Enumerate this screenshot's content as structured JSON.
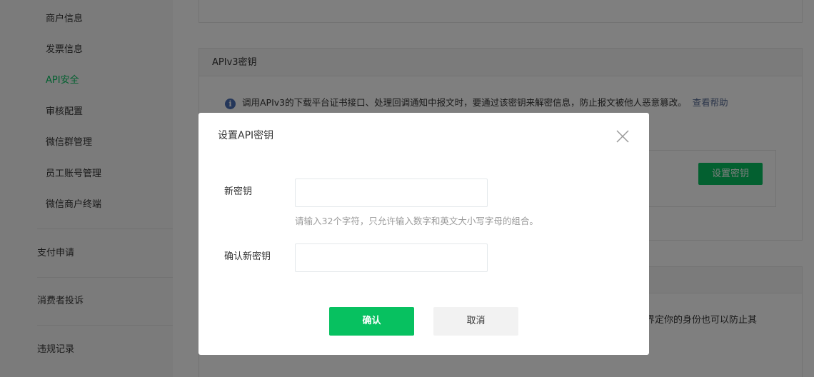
{
  "sidebar": {
    "sub_items": [
      {
        "label": "商户信息",
        "active": false
      },
      {
        "label": "发票信息",
        "active": false
      },
      {
        "label": "API安全",
        "active": true
      },
      {
        "label": "审核配置",
        "active": false
      },
      {
        "label": "微信群管理",
        "active": false
      },
      {
        "label": "员工账号管理",
        "active": false
      },
      {
        "label": "微信商户终端",
        "active": false
      }
    ],
    "main_items": [
      {
        "label": "支付申请"
      },
      {
        "label": "消费者投诉"
      },
      {
        "label": "违规记录"
      }
    ]
  },
  "main": {
    "apiv3_card": {
      "title": "APIv3密钥",
      "info_icon": "info-icon",
      "info_text": "调用APIv3的下载平台证书接口、处理回调通知中报文时，要通过该密钥来解密信息，防止报文被他人恶意篡改。",
      "help_link": "查看帮助",
      "set_key_button": "设置密钥"
    },
    "lower_card": {
      "partial_text": "可以界定你的身份也可以防止其"
    }
  },
  "dialog": {
    "title": "设置API密钥",
    "close_icon": "close-icon",
    "new_key": {
      "label": "新密钥",
      "value": "",
      "placeholder": ""
    },
    "hint": "请输入32个字符，只允许输入数字和英文大小写字母的组合。",
    "confirm_key": {
      "label": "确认新密钥",
      "value": "",
      "placeholder": ""
    },
    "confirm_button": "确认",
    "cancel_button": "取消"
  },
  "colors": {
    "brand_green": "#07c160",
    "link_blue": "#576b95",
    "overlay": "rgba(0,0,0,0.5)"
  }
}
